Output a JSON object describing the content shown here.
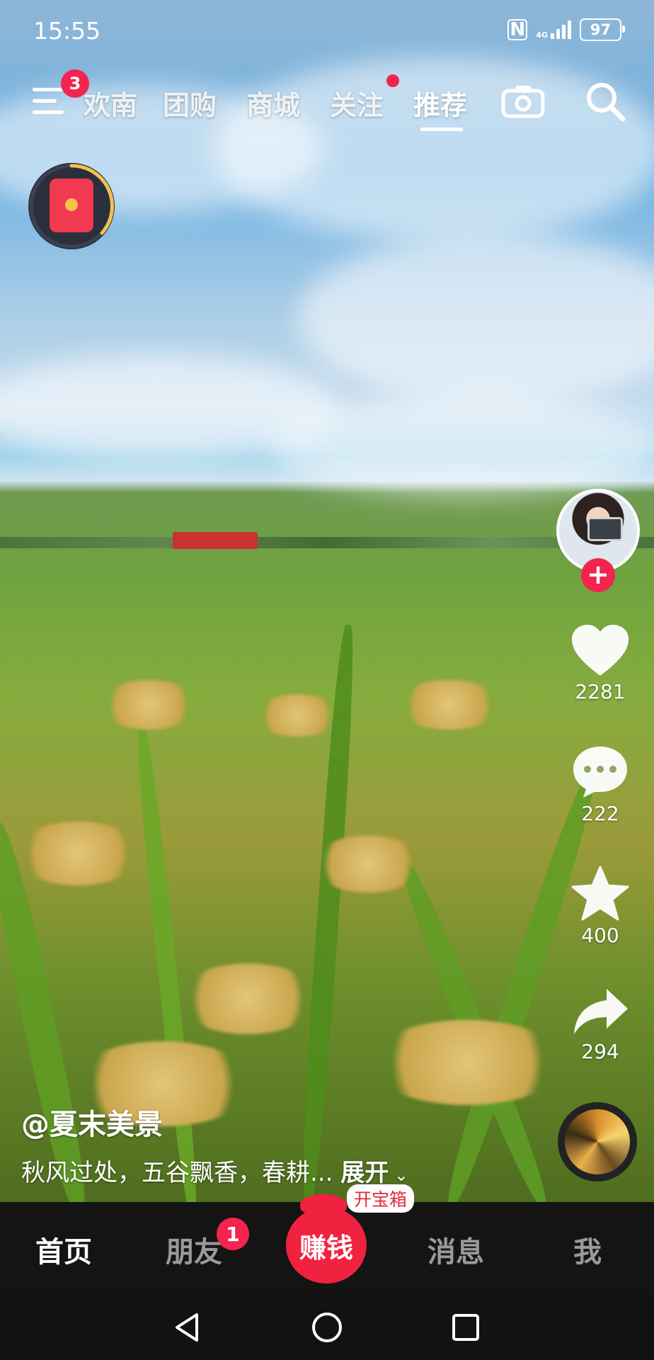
{
  "status_bar": {
    "time": "15:55",
    "network": "4G",
    "battery": "97"
  },
  "top_nav": {
    "menu_badge": "3",
    "tabs": [
      {
        "label": "欢南"
      },
      {
        "label": "团购"
      },
      {
        "label": "商城"
      },
      {
        "label": "关注"
      },
      {
        "label": "推荐"
      }
    ],
    "active_tab": "推荐"
  },
  "video": {
    "author": "@夏末美景",
    "caption": "秋风过处，五谷飘香，春耕...",
    "expand_label": "展开",
    "likes": "2281",
    "comments": "222",
    "favorites": "400",
    "shares": "294"
  },
  "bottom_nav": {
    "home": "首页",
    "friends": "朋友",
    "friends_badge": "1",
    "earn": "赚钱",
    "treasure_label": "开宝箱",
    "messages": "消息",
    "me": "我"
  },
  "colors": {
    "accent": "#f3244d",
    "nav_bg": "#141414"
  },
  "icons": [
    "menu-icon",
    "camera-icon",
    "search-icon",
    "red-packet-icon",
    "heart-icon",
    "comment-icon",
    "star-icon",
    "share-icon",
    "back-icon",
    "home-icon",
    "recents-icon"
  ]
}
